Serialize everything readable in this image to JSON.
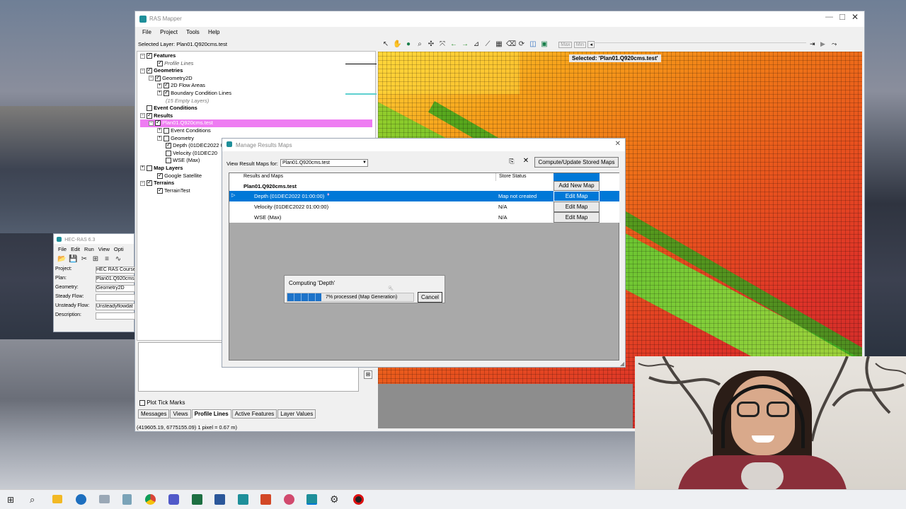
{
  "ras_mapper": {
    "title": "RAS Mapper",
    "menu": [
      "File",
      "Project",
      "Tools",
      "Help"
    ],
    "selected_layer": "Selected Layer: Plan01.Q920cms.test",
    "layers": {
      "features": "Features",
      "profile_lines": "Profile Lines",
      "geometries": "Geometries",
      "geometry2d": "Geometry2D",
      "flow_areas": "2D Flow Areas",
      "bc_lines": "Boundary Condition Lines",
      "empty_layers": "(15 Empty Layers)",
      "event_conditions": "Event Conditions",
      "results": "Results",
      "plan": "Plan01.Q920cms.test",
      "event_conditions_sub": "Event Conditions",
      "geometry": "Geometry",
      "depth": "Depth (01DEC2022 0",
      "velocity": "Velocity (01DEC20",
      "wse": "WSE (Max)",
      "map_layers": "Map Layers",
      "google": "Google Satellite",
      "terrains": "Terrains",
      "terrain_test": "TerrainTest"
    },
    "toolbar_labels": {
      "max": "Max",
      "min": "Min"
    },
    "map_selected": "Selected: 'Plan01.Q920cms.test'",
    "plot_tick_marks": "Plot Tick Marks",
    "tabs": [
      "Messages",
      "Views",
      "Profile Lines",
      "Active Features",
      "Layer Values"
    ],
    "selected_tab": "Profile Lines",
    "status": "(419605.19, 6775155.09)  1 pixel = 0.67 m)"
  },
  "hec_ras": {
    "title": "HEC-RAS 6.3",
    "menu": [
      "File",
      "Edit",
      "Run",
      "View",
      "Opti"
    ],
    "fields": [
      {
        "label": "Project:",
        "value": "HEC RAS Course"
      },
      {
        "label": "Plan:",
        "value": "Plan01.Q920cms"
      },
      {
        "label": "Geometry:",
        "value": "Geometry2D"
      },
      {
        "label": "Steady Flow:",
        "value": ""
      },
      {
        "label": "Unsteady Flow:",
        "value": "Unsteadyflowdat"
      },
      {
        "label": "Description:",
        "value": ""
      }
    ]
  },
  "manage": {
    "title": "Manage Results Maps",
    "view_for_label": "View Result Maps for:",
    "view_for_value": "Plan01.Q920cms.test",
    "compute_button": "Compute/Update Stored Maps",
    "col_results": "Results and Maps",
    "col_status": "Store Status",
    "plan_row": "Plan01.Q920cms.test",
    "add_button": "Add New Map",
    "rows": [
      {
        "name": "Depth (01DEC2022 01:00:00)",
        "status": "Map not created",
        "action": "Edit Map"
      },
      {
        "name": "Velocity (01DEC2022 01:00:00)",
        "status": "N/A",
        "action": "Edit Map"
      },
      {
        "name": "WSE (Max)",
        "status": "N/A",
        "action": "Edit Map"
      }
    ]
  },
  "progress": {
    "title": "Computing 'Depth'",
    "text": "7% processed (Map Generation)",
    "fraction": 0.27,
    "cancel": "Cancel"
  },
  "taskbar": {
    "icons": [
      "windows-start-icon",
      "search-icon",
      "file-explorer-icon",
      "quickassist-icon",
      "mail-icon",
      "notes-icon",
      "chrome-icon",
      "teams-icon",
      "excel-icon",
      "word-icon",
      "hecras-icon",
      "powerpoint-icon",
      "snip-icon",
      "rasmapper-icon",
      "settings-icon",
      "record-icon"
    ]
  },
  "colors": {
    "accent": "#0078d7",
    "highlight": "#ee7cf2",
    "title_bar": "#1e8f9a"
  }
}
